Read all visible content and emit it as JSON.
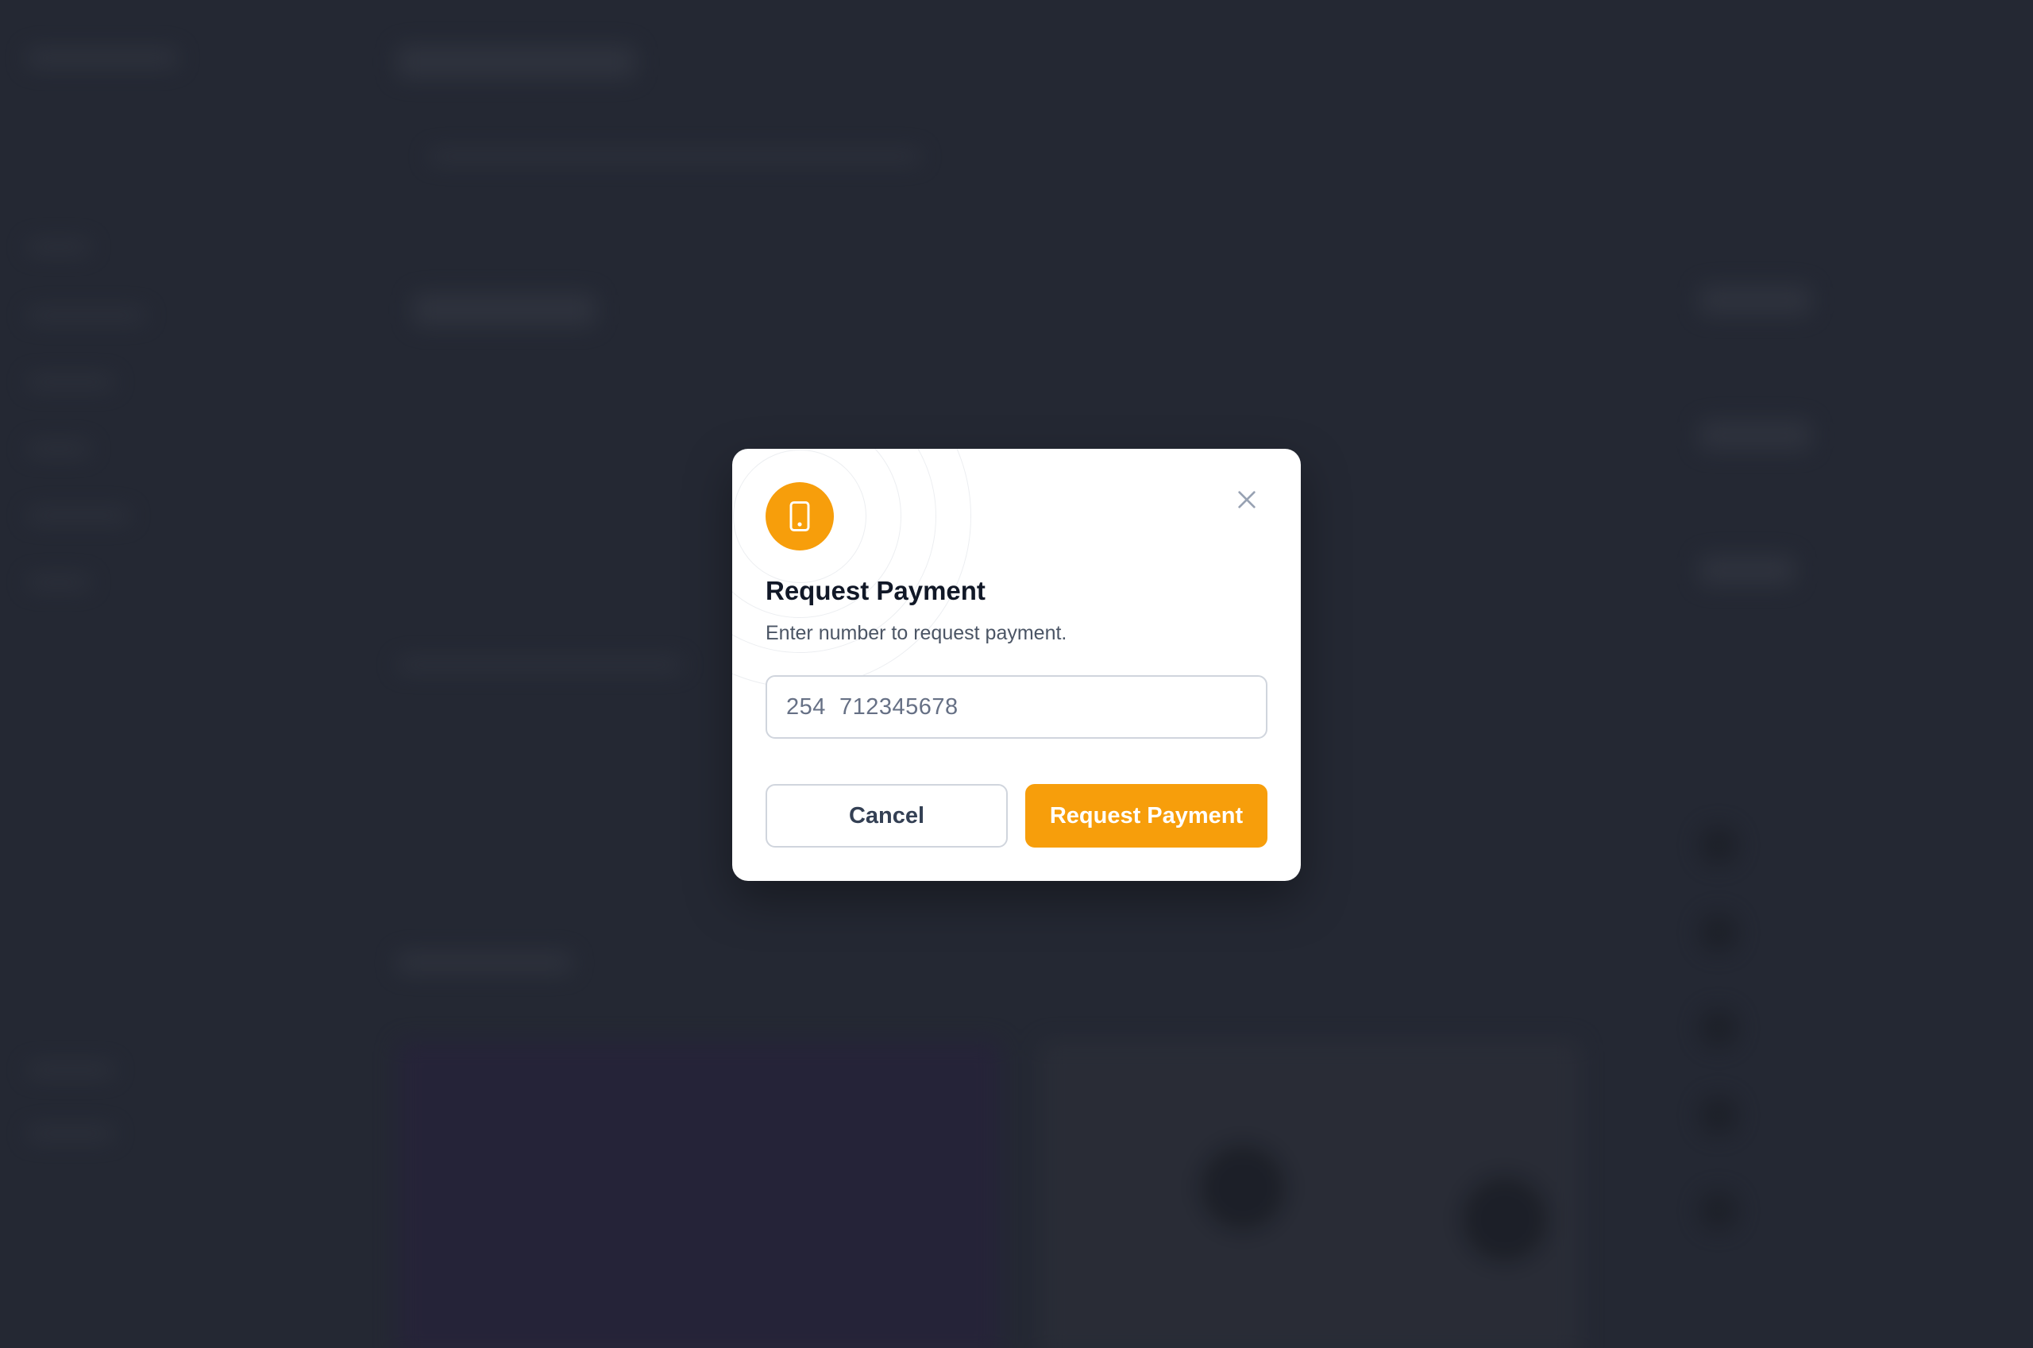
{
  "modal": {
    "title": "Request Payment",
    "subtitle": "Enter number to request payment.",
    "phone_input": {
      "placeholder": "254  712345678",
      "value": ""
    },
    "cancel_label": "Cancel",
    "submit_label": "Request Payment",
    "icons": {
      "header": "tablet-icon",
      "close": "close-icon"
    }
  },
  "colors": {
    "accent": "#f79e0b",
    "overlay": "#242833",
    "title": "#111827",
    "subtitle": "#4b5565",
    "border": "#d0d5dd"
  }
}
